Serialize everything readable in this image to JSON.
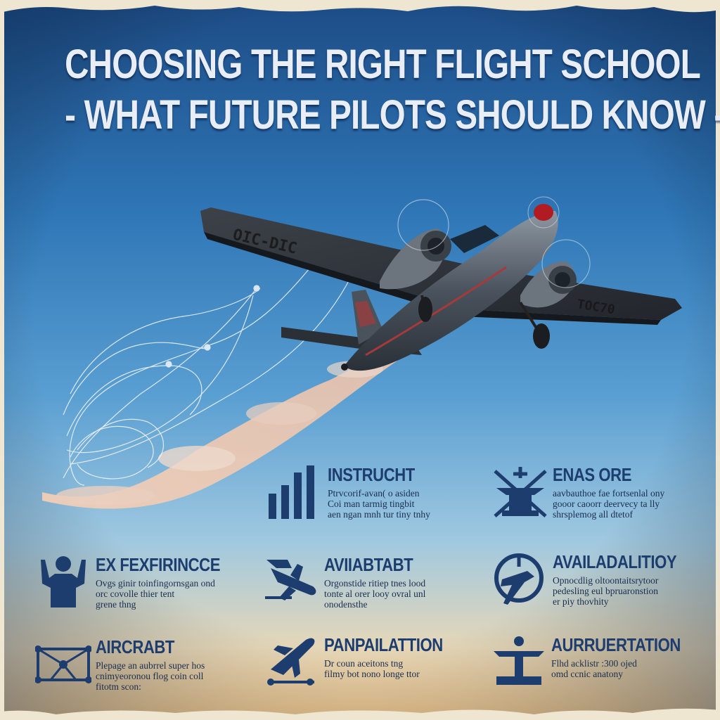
{
  "title": {
    "line1": "CHOOSING THE RIGHT FLIGHT SCHOOL",
    "line2": "- WHAT FUTURE PILOTS SHOULD KNOW -"
  },
  "features": [
    {
      "icon": "bar-chart-icon",
      "title": "INSTRUCHT",
      "lines": [
        "Ptrvcorif-avan( o asiden",
        "Coi man tarmig tingbit",
        "aen ngan mnh tur tiny tnhy"
      ]
    },
    {
      "icon": "aircraft-front-icon",
      "title": "ENAS ORE",
      "lines": [
        "aavbauthoe fae fortsenlal ony",
        "gooor caoorr deervecy ta lly",
        "shrsplemog all dtetof"
      ]
    },
    {
      "icon": "pilot-person-icon",
      "title": "EX FEXFIRINCCE",
      "lines": [
        "Ovgs ginir toinfingornsgan ond",
        "orc covolle thier tent",
        "grene thng"
      ]
    },
    {
      "icon": "airplane-icon",
      "title": "AVIIABTABT",
      "lines": [
        "Orgonstide ritiep tnes lood",
        "tonte al orer looy ovral unl",
        "onodensthe"
      ]
    },
    {
      "icon": "compass-plane-icon",
      "title": "AVAILADALITIOY",
      "lines": [
        "Opnocdlig oltoontaitsrytoor",
        "pedesling eul bpruaronstion",
        "er piy thovhity"
      ]
    },
    {
      "icon": "aircraft-wireframe-icon",
      "title": "AIRCRABT",
      "lines": [
        "Plepage an aubrrel super hos",
        "cnimyeoronou flog coin coll",
        "fitotm scon:"
      ]
    },
    {
      "icon": "takeoff-icon",
      "title": "PANPAILATTION",
      "lines": [
        "Dr coun aceitons tng",
        "filmy bot nono longe ttor"
      ]
    },
    {
      "icon": "pedestal-icon",
      "title": "AURRUERTATION",
      "lines": [
        "Flhd acklistr :300 ojed",
        "omd ccnic anatony"
      ]
    }
  ]
}
